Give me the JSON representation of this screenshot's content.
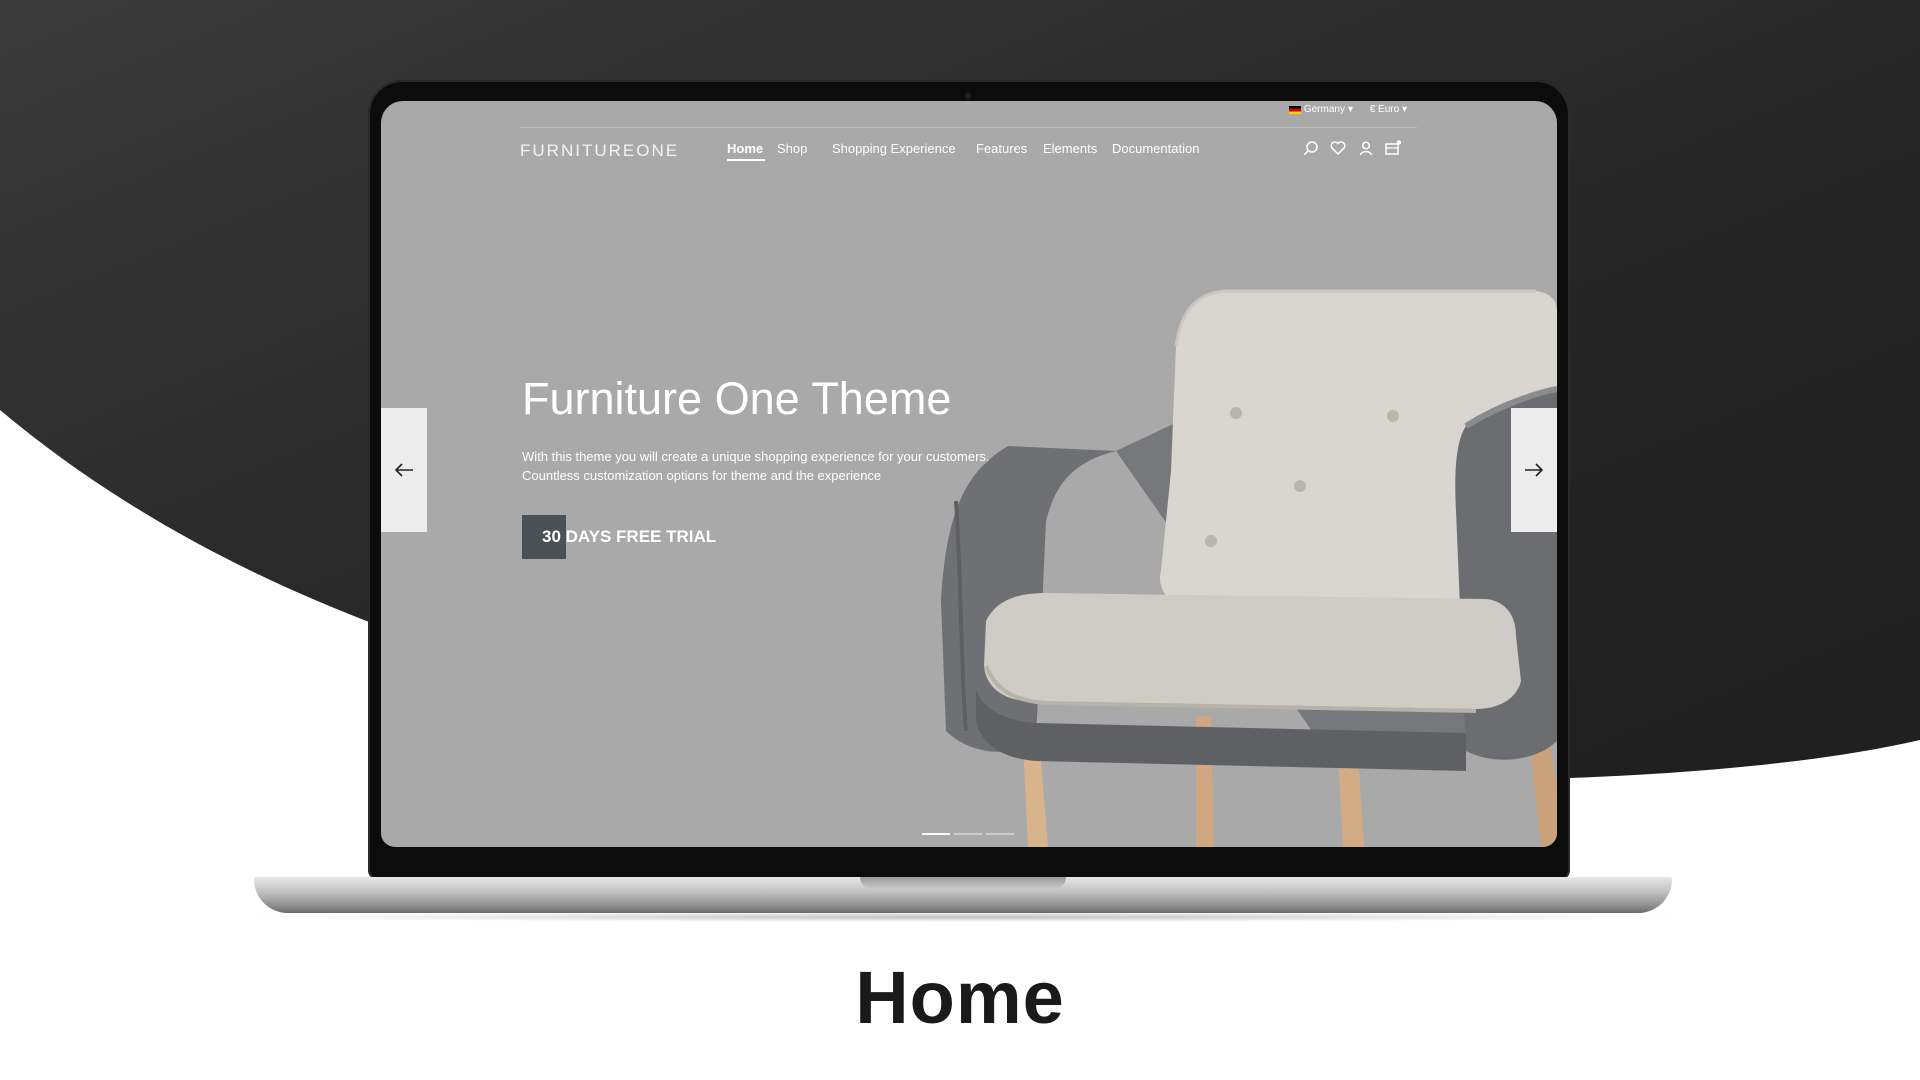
{
  "colors": {
    "dark_background": "#262626",
    "hero_background": "#a9a9a9",
    "cta_box": "#4c5157",
    "text_white": "#ffffff",
    "caption": "#1a1a1a"
  },
  "topbar": {
    "country": "Germany",
    "country_flag": "german-flag-icon",
    "currency": "€ Euro"
  },
  "header": {
    "logo": "FURNITUREONE",
    "nav": [
      {
        "label": "Home",
        "active": true
      },
      {
        "label": "Shop"
      },
      {
        "label": "Shopping Experience"
      },
      {
        "label": "Features"
      },
      {
        "label": "Elements"
      },
      {
        "label": "Documentation"
      }
    ],
    "icons": [
      "search-icon",
      "heart-icon",
      "user-icon",
      "cart-icon"
    ]
  },
  "hero": {
    "title": "Furniture One Theme",
    "text": "With this theme you will create a unique shopping experience for your customers. Countless customization options for theme and the experience",
    "cta_label": "30 DAYS FREE TRIAL",
    "slide_count": 3,
    "active_slide": 1
  },
  "caption": "Home"
}
